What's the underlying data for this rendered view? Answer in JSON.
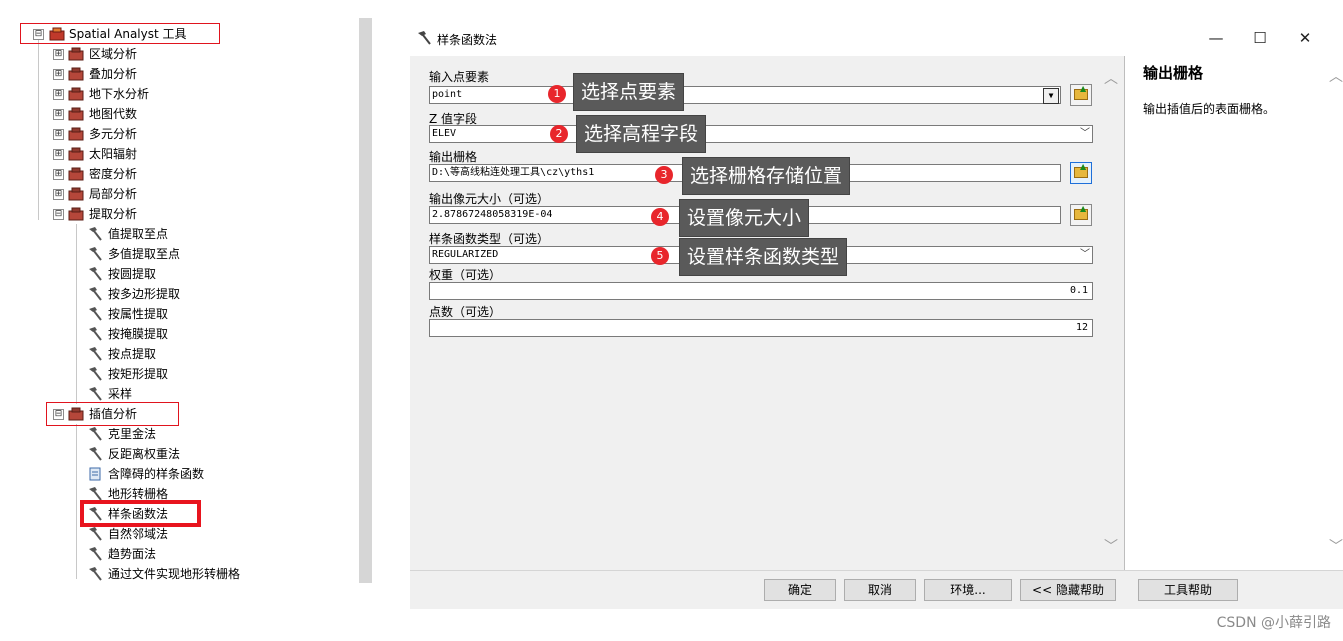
{
  "tree": {
    "root": {
      "label": "Spatial Analyst 工具",
      "expander": "⊟"
    },
    "toolsets": [
      {
        "label": "区域分析",
        "expander": "⊞"
      },
      {
        "label": "叠加分析",
        "expander": "⊞"
      },
      {
        "label": "地下水分析",
        "expander": "⊞"
      },
      {
        "label": "地图代数",
        "expander": "⊞"
      },
      {
        "label": "多元分析",
        "expander": "⊞"
      },
      {
        "label": "太阳辐射",
        "expander": "⊞"
      },
      {
        "label": "密度分析",
        "expander": "⊞"
      },
      {
        "label": "局部分析",
        "expander": "⊞"
      },
      {
        "label": "提取分析",
        "expander": "⊟"
      }
    ],
    "extract_tools": [
      "值提取至点",
      "多值提取至点",
      "按圆提取",
      "按多边形提取",
      "按属性提取",
      "按掩膜提取",
      "按点提取",
      "按矩形提取",
      "采样"
    ],
    "interp_toolset": {
      "label": "插值分析",
      "expander": "⊟"
    },
    "interp_tools": [
      "克里金法",
      "反距离权重法",
      "含障碍的样条函数",
      "地形转栅格",
      "样条函数法",
      "自然邻域法",
      "趋势面法",
      "通过文件实现地形转栅格"
    ]
  },
  "dialog": {
    "title": "样条函数法",
    "window_buttons": {
      "minimize": "—",
      "maximize": "☐",
      "close": "✕"
    },
    "fields": [
      {
        "label": "输入点要素",
        "value": "point"
      },
      {
        "label": "Z 值字段",
        "value": "ELEV"
      },
      {
        "label": "输出栅格",
        "value": "D:\\等高线粘连处理工具\\cz\\yths1"
      },
      {
        "label": "输出像元大小（可选）",
        "value": "2.87867248058319E-04"
      },
      {
        "label": "样条函数类型（可选）",
        "value": "REGULARIZED"
      },
      {
        "label": "权重（可选）",
        "value": "0.1"
      },
      {
        "label": "点数（可选）",
        "value": "12"
      }
    ],
    "callouts": [
      {
        "num": "1",
        "text": "选择点要素"
      },
      {
        "num": "2",
        "text": "选择高程字段"
      },
      {
        "num": "3",
        "text": "选择栅格存储位置"
      },
      {
        "num": "4",
        "text": "设置像元大小"
      },
      {
        "num": "5",
        "text": "设置样条函数类型"
      }
    ],
    "help": {
      "title": "输出栅格",
      "body": "输出插值后的表面栅格。"
    },
    "buttons": {
      "ok": "确定",
      "cancel": "取消",
      "env": "环境...",
      "hide_help": "<< 隐藏帮助",
      "tool_help": "工具帮助"
    }
  },
  "watermark": "CSDN @小薛引路",
  "colors": {
    "callout_bg": "#5a5a5a",
    "callout_num": "#e8262c",
    "highlight_box": "#e0141e"
  }
}
